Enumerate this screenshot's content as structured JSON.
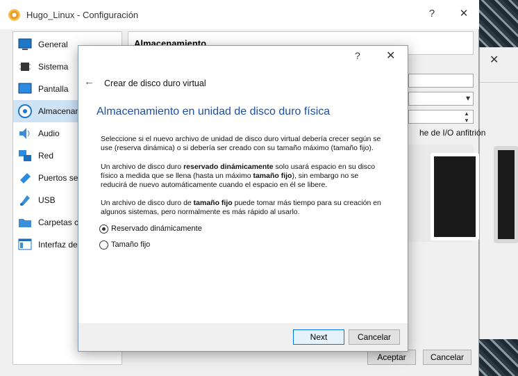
{
  "main_window": {
    "title": "Hugo_Linux - Configuración",
    "help": "?",
    "close": "✕",
    "sidebar": {
      "items": [
        {
          "label": "General"
        },
        {
          "label": "Sistema"
        },
        {
          "label": "Pantalla"
        },
        {
          "label": "Almacenam"
        },
        {
          "label": "Audio"
        },
        {
          "label": "Red"
        },
        {
          "label": "Puertos ser"
        },
        {
          "label": "USB"
        },
        {
          "label": "Carpetas co"
        },
        {
          "label": "Interfaz de"
        }
      ],
      "selected_index": 3
    },
    "section_title": "Almacenamiento",
    "host_cache_fragment": "he de I/O anfitrión",
    "accept_button": "Aceptar",
    "cancel_button": "Cancelar"
  },
  "wizard": {
    "help": "?",
    "close": "✕",
    "back": "←",
    "title": "Crear de disco duro virtual",
    "heading": "Almacenamiento en unidad de disco duro física",
    "para1": "Seleccione si el nuevo archivo de unidad de disco duro virtual debería crecer según se use (reserva dinámica) o si debería ser creado con su tamaño máximo (tamaño fijo).",
    "para2": {
      "t1": "Un archivo de disco duro ",
      "b1": "reservado dinámicamente",
      "t2": " solo usará espacio en su disco físico a medida que se llena (hasta un máximo ",
      "b2": "tamaño fijo",
      "t3": "), sin embargo no se reducirá de nuevo automáticamente cuando el espacio en él se libere."
    },
    "para3": {
      "t1": "Un archivo de disco duro de ",
      "b1": "tamaño fijo",
      "t2": " puede tomar más tiempo para su creación en algunos sistemas, pero normalmente es más rápido al usarlo."
    },
    "options": [
      {
        "label": "Reservado dinámicamente",
        "checked": true
      },
      {
        "label": "Tamaño fijo",
        "checked": false
      }
    ],
    "next_button": "Next",
    "cancel_button": "Cancelar"
  },
  "behind_window": {
    "close": "✕"
  }
}
